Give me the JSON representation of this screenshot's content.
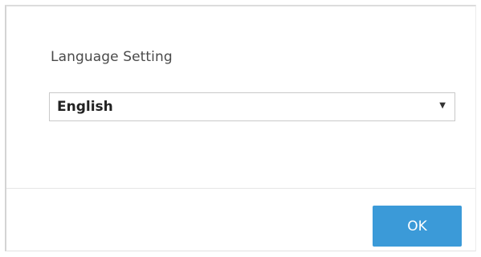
{
  "dialog": {
    "label": "Language Setting",
    "select": {
      "value": "English",
      "arrow_icon": "caret-down-icon",
      "arrow_glyph": "▼"
    },
    "ok_label": "OK"
  },
  "colors": {
    "accent": "#3b9ad8"
  }
}
